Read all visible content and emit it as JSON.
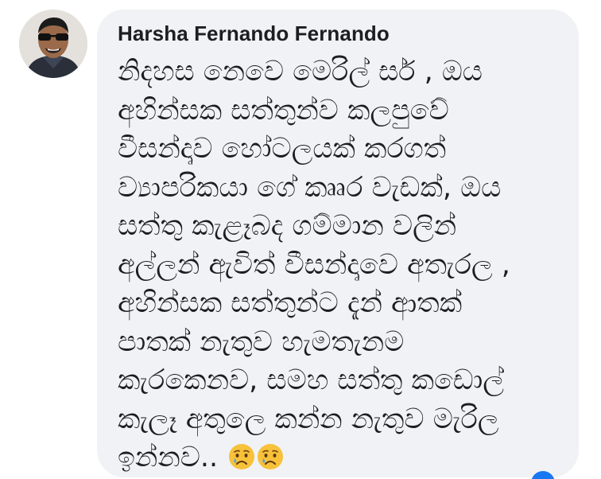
{
  "comment": {
    "author": "Harsha Fernando Fernando",
    "lines": [
      "නිදහස නෙවෙ මෙරිල් සර් , ඔය",
      "අහින්සක සත්තුන්ව කලපුවේ",
      "වීසන්ද්‍රුව හෝටලයක් කරගත්",
      "ව්‍යාපරිකයා ගේ කෲර වැඩක්, ඔය",
      "සත්තු කැළෑබද ගම්මාන වලින්",
      "අල්ලන් ඇවිත් වීසන්ද්‍රුවෙ අතැරල ,",
      "අහින්සක සත්තුන්ට දැන් ආතක්",
      "පාතක් නැතුව හැමතැනම",
      "කැරකෙනව, සමහ සත්තු කඩොල්",
      "කැලෑ අතුලෙ කන්න නැතුව මැරිල",
      "ඉන්නව.."
    ],
    "emojis": [
      "crying-face",
      "crying-face"
    ]
  },
  "colors": {
    "bubble": "#f0f2f5",
    "text": "#1c1e21",
    "reaction": "#1877f2"
  }
}
